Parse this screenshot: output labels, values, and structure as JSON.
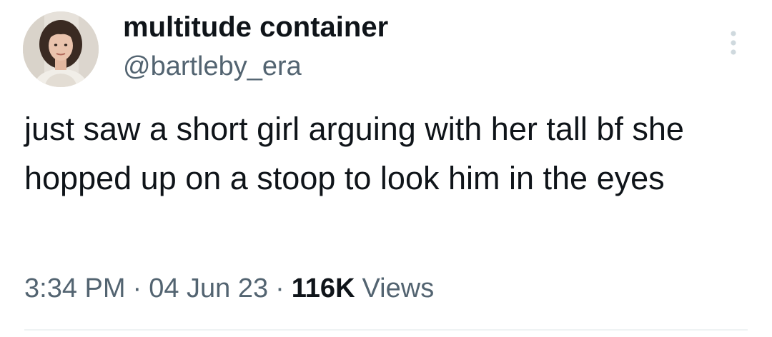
{
  "author": {
    "display_name": "multitude container",
    "handle": "@bartleby_era",
    "avatar_icon": "profile-photo"
  },
  "tweet": {
    "text": "just saw a short girl arguing with her tall bf she hopped up on a stoop to look him in the eyes"
  },
  "meta": {
    "time": "3:34 PM",
    "date": "04 Jun 23",
    "separator": "·",
    "views_count": "116K",
    "views_label": "Views"
  },
  "icons": {
    "more": "more-vertical-icon"
  },
  "colors": {
    "primary_text": "#0f1419",
    "secondary_text": "#536471",
    "divider": "#eff3f4",
    "background": "#ffffff"
  }
}
